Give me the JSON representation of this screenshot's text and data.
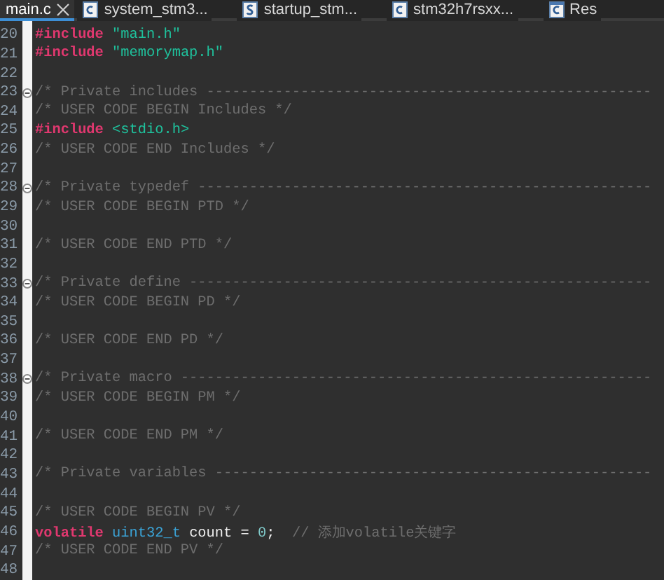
{
  "tabs": [
    {
      "label": "main.c",
      "selected": true,
      "kind": "plain",
      "closable": true
    },
    {
      "label": "system_stm3...",
      "selected": false,
      "kind": "c",
      "closable": false
    },
    {
      "label": "startup_stm...",
      "selected": false,
      "kind": "s",
      "closable": false
    },
    {
      "label": "stm32h7rsxx...",
      "selected": false,
      "kind": "c",
      "closable": false
    },
    {
      "label": "Res",
      "selected": false,
      "kind": "c-box",
      "closable": false
    }
  ],
  "lines": [
    {
      "number": "20",
      "fold": false,
      "tokens": [
        {
          "kind": "directive",
          "text": "#include "
        },
        {
          "kind": "string",
          "text": "\"main.h\""
        }
      ]
    },
    {
      "number": "21",
      "fold": false,
      "tokens": [
        {
          "kind": "directive",
          "text": "#include "
        },
        {
          "kind": "string",
          "text": "\"memorymap.h\""
        }
      ]
    },
    {
      "number": "22",
      "fold": false
    },
    {
      "number": "23",
      "fold": true,
      "tokens": [
        {
          "kind": "comment",
          "text": "/* Private includes ----------------------------------------------------"
        }
      ]
    },
    {
      "number": "24",
      "fold": false,
      "tokens": [
        {
          "kind": "comment",
          "text": "/* USER CODE BEGIN Includes */"
        }
      ]
    },
    {
      "number": "25",
      "fold": false,
      "tokens": [
        {
          "kind": "directive",
          "text": "#include "
        },
        {
          "kind": "string",
          "text": "<stdio.h>"
        }
      ]
    },
    {
      "number": "26",
      "fold": false,
      "tokens": [
        {
          "kind": "comment",
          "text": "/* USER CODE END Includes */"
        }
      ]
    },
    {
      "number": "27",
      "fold": false
    },
    {
      "number": "28",
      "fold": true,
      "tokens": [
        {
          "kind": "comment",
          "text": "/* Private typedef -----------------------------------------------------"
        }
      ]
    },
    {
      "number": "29",
      "fold": false,
      "tokens": [
        {
          "kind": "comment",
          "text": "/* USER CODE BEGIN PTD */"
        }
      ]
    },
    {
      "number": "30",
      "fold": false
    },
    {
      "number": "31",
      "fold": false,
      "tokens": [
        {
          "kind": "comment",
          "text": "/* USER CODE END PTD */"
        }
      ]
    },
    {
      "number": "32",
      "fold": false
    },
    {
      "number": "33",
      "fold": true,
      "tokens": [
        {
          "kind": "comment",
          "text": "/* Private define ------------------------------------------------------"
        }
      ]
    },
    {
      "number": "34",
      "fold": false,
      "tokens": [
        {
          "kind": "comment",
          "text": "/* USER CODE BEGIN PD */"
        }
      ]
    },
    {
      "number": "35",
      "fold": false
    },
    {
      "number": "36",
      "fold": false,
      "tokens": [
        {
          "kind": "comment",
          "text": "/* USER CODE END PD */"
        }
      ]
    },
    {
      "number": "37",
      "fold": false
    },
    {
      "number": "38",
      "fold": true,
      "tokens": [
        {
          "kind": "comment",
          "text": "/* Private macro -------------------------------------------------------"
        }
      ]
    },
    {
      "number": "39",
      "fold": false,
      "tokens": [
        {
          "kind": "comment",
          "text": "/* USER CODE BEGIN PM */"
        }
      ]
    },
    {
      "number": "40",
      "fold": false
    },
    {
      "number": "41",
      "fold": false,
      "tokens": [
        {
          "kind": "comment",
          "text": "/* USER CODE END PM */"
        }
      ]
    },
    {
      "number": "42",
      "fold": false
    },
    {
      "number": "43",
      "fold": false,
      "tokens": [
        {
          "kind": "comment",
          "text": "/* Private variables ---------------------------------------------------"
        }
      ]
    },
    {
      "number": "44",
      "fold": false
    },
    {
      "number": "45",
      "fold": false,
      "tokens": [
        {
          "kind": "comment",
          "text": "/* USER CODE BEGIN PV */"
        }
      ]
    },
    {
      "number": "46",
      "fold": false,
      "tokens": [
        {
          "kind": "keyword",
          "text": "volatile "
        },
        {
          "kind": "type",
          "text": "uint32_t"
        },
        {
          "kind": "plain",
          "text": " count = "
        },
        {
          "kind": "number",
          "text": "0"
        },
        {
          "kind": "plain",
          "text": ";  "
        },
        {
          "kind": "comment",
          "text": "// 添加volatile关键字"
        }
      ]
    },
    {
      "number": "47",
      "fold": false,
      "tokens": [
        {
          "kind": "comment",
          "text": "/* USER CODE END PV */"
        }
      ]
    },
    {
      "number": "48",
      "fold": false
    }
  ]
}
